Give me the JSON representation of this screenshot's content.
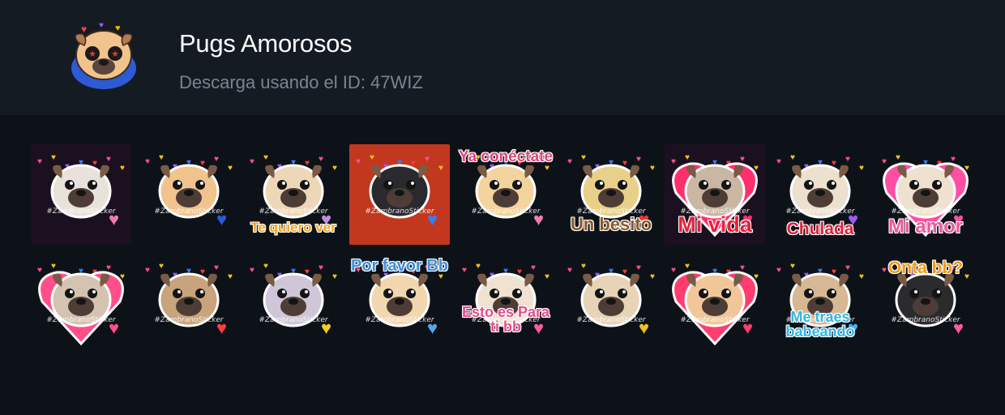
{
  "pack": {
    "title": "Pugs Amorosos",
    "subtitle": "Descarga usando el ID: 47WIZ",
    "icon": "pug-star-eyes-sticker",
    "watermark": "#ZambranoSticker"
  },
  "colors": {
    "header_bg": "#151b23",
    "page_bg": "#0d1219",
    "title": "#ffffff",
    "subtitle": "#7c848e"
  },
  "stickers": [
    {
      "icon": "pug-heart-collage-sticker"
    },
    {
      "icon": "pug-star-eyes-sticker"
    },
    {
      "icon": "pug-thinking-sticker",
      "caption": "Te quiero ver"
    },
    {
      "icon": "black-pugs-couple-sticker"
    },
    {
      "icon": "pug-sleeping-sticker",
      "caption": "Ya conéctate"
    },
    {
      "icon": "pug-kiss-sticker",
      "caption": "Un besito"
    },
    {
      "icon": "pug-big-heart-sticker",
      "caption": "Mi vida"
    },
    {
      "icon": "pug-blowing-kiss-sticker",
      "caption": "Chulada"
    },
    {
      "icon": "pug-blue-eyes-sticker",
      "caption": "Mi amor"
    },
    {
      "icon": "pug-pink-heart-sticker"
    },
    {
      "icon": "pug-tongue-heart-sticker"
    },
    {
      "icon": "pug-unicorn-rainbow-sticker"
    },
    {
      "icon": "pug-melting-sticker",
      "caption": "Por favor Bb"
    },
    {
      "icon": "pug-giving-heart-sticker",
      "caption": "Esto es Para ti bb"
    },
    {
      "icon": "pug-laughing-sticker"
    },
    {
      "icon": "pug-hearts-cuddle-sticker"
    },
    {
      "icon": "pug-wide-eyes-sticker",
      "caption": "Me traes babeando"
    },
    {
      "icon": "black-pug-hearts-sticker",
      "caption": "Onta bb?"
    }
  ]
}
